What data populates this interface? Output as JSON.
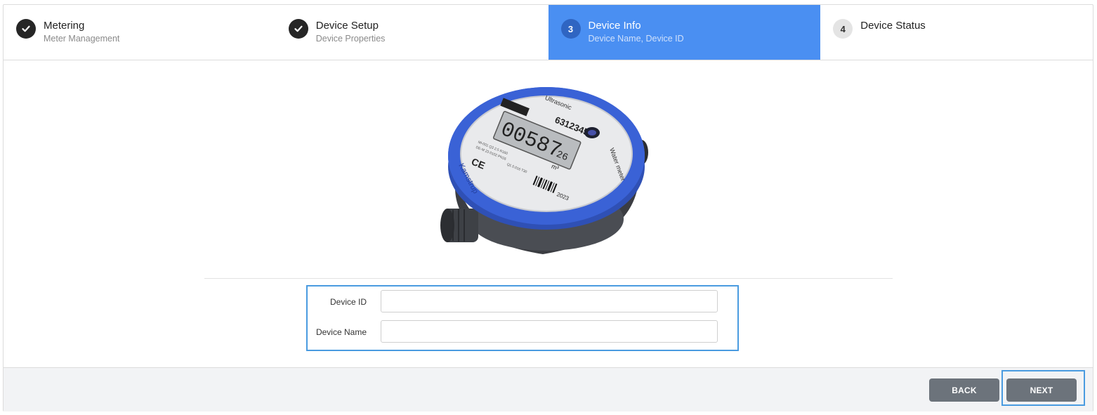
{
  "steps": [
    {
      "number": "",
      "title": "Metering",
      "subtitle": "Meter Management",
      "state": "done"
    },
    {
      "number": "",
      "title": "Device Setup",
      "subtitle": "Device Properties",
      "state": "done"
    },
    {
      "number": "3",
      "title": "Device Info",
      "subtitle": "Device Name, Device ID",
      "state": "active"
    },
    {
      "number": "4",
      "title": "Device Status",
      "subtitle": "",
      "state": "pending"
    }
  ],
  "meter": {
    "label_top": "Ultrasonic",
    "serial": "63123456",
    "reading": "00587",
    "reading_decimal": "26",
    "unit": "m³",
    "side_text": "Water meter",
    "brand": "Kamstrup",
    "year": "2023",
    "ce": "CE"
  },
  "form": {
    "device_id_label": "Device ID",
    "device_id_value": "",
    "device_name_label": "Device Name",
    "device_name_value": ""
  },
  "footer": {
    "back_label": "BACK",
    "next_label": "NEXT"
  },
  "colors": {
    "active_step": "#4a8ff2",
    "highlight_border": "#4a9be0",
    "button": "#6c737b",
    "meter_ring": "#3a62d6"
  }
}
